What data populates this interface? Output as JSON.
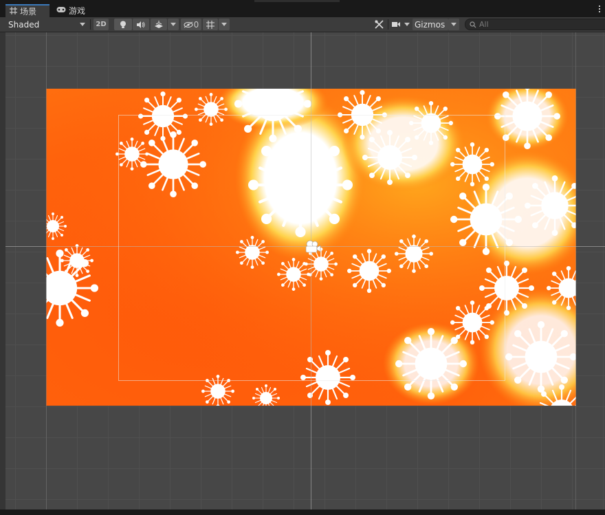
{
  "tabs": [
    {
      "label": "场景",
      "icon": "grid-icon",
      "active": true
    },
    {
      "label": "游戏",
      "icon": "gamepad-icon",
      "active": false
    }
  ],
  "toolbar": {
    "shading_mode": "Shaded",
    "mode_2d_label": "2D",
    "hidden_count": "0",
    "gizmos_label": "Gizmos",
    "search_placeholder": "All"
  },
  "colors": {
    "background_orange": "#ff620c",
    "fractal_white": "#ffffff",
    "fractal_yellow": "#ffb020",
    "accent_tab": "#3a79bb"
  },
  "scene": {
    "content": "orange-fractal-quad",
    "camera_icon": "camera-icon"
  }
}
